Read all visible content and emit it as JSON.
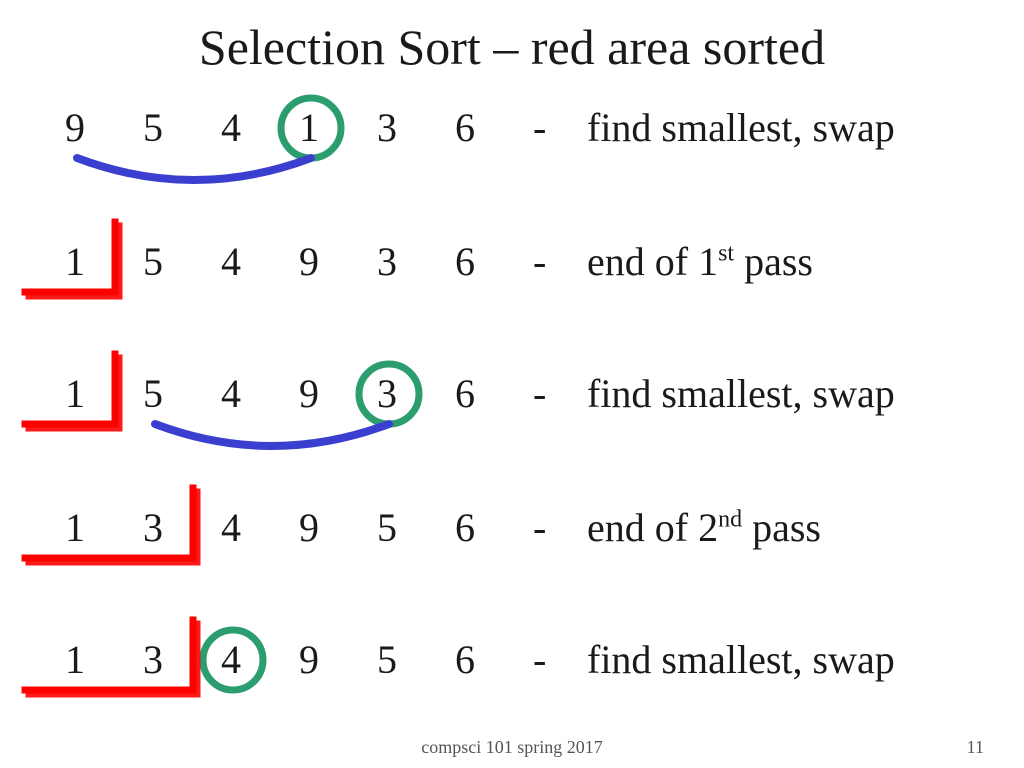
{
  "title": "Selection Sort – red area sorted",
  "rows": [
    {
      "vals": [
        "9",
        "5",
        "4",
        "1",
        "3",
        "6"
      ],
      "dash": "-",
      "caption": "find smallest, swap",
      "circleIndex": 3,
      "swapFrom": 0,
      "swapTo": 3,
      "bracketUpTo": -1
    },
    {
      "vals": [
        "1",
        "5",
        "4",
        "9",
        "3",
        "6"
      ],
      "dash": "-",
      "caption": "end of 1",
      "sup": "st",
      "captionTail": " pass",
      "circleIndex": -1,
      "swapFrom": -1,
      "swapTo": -1,
      "bracketUpTo": 0
    },
    {
      "vals": [
        "1",
        "5",
        "4",
        "9",
        "3",
        "6"
      ],
      "dash": "-",
      "caption": "find smallest, swap",
      "circleIndex": 4,
      "swapFrom": 1,
      "swapTo": 4,
      "bracketUpTo": 0
    },
    {
      "vals": [
        "1",
        "3",
        "4",
        "9",
        "5",
        "6"
      ],
      "dash": "-",
      "caption": "end of 2",
      "sup": "nd",
      "captionTail": "  pass",
      "circleIndex": -1,
      "swapFrom": -1,
      "swapTo": -1,
      "bracketUpTo": 1
    },
    {
      "vals": [
        "1",
        "3",
        "4",
        "9",
        "5",
        "6"
      ],
      "dash": "-",
      "caption": "find smallest, swap",
      "circleIndex": 2,
      "swapFrom": -1,
      "swapTo": -1,
      "bracketUpTo": 1
    }
  ],
  "footer": "compsci 101 spring 2017",
  "pageNumber": "11",
  "layout": {
    "rowLeft": 65,
    "rowTops": [
      104,
      238,
      370,
      504,
      636
    ],
    "numWidth": 78,
    "numCenterOffset": 12,
    "rowBaselineOffset": 24,
    "circleRadius": 30,
    "colors": {
      "circle": "#2b9d6e",
      "swap": "#3a3fd0",
      "bracket": "#ff0000"
    }
  }
}
